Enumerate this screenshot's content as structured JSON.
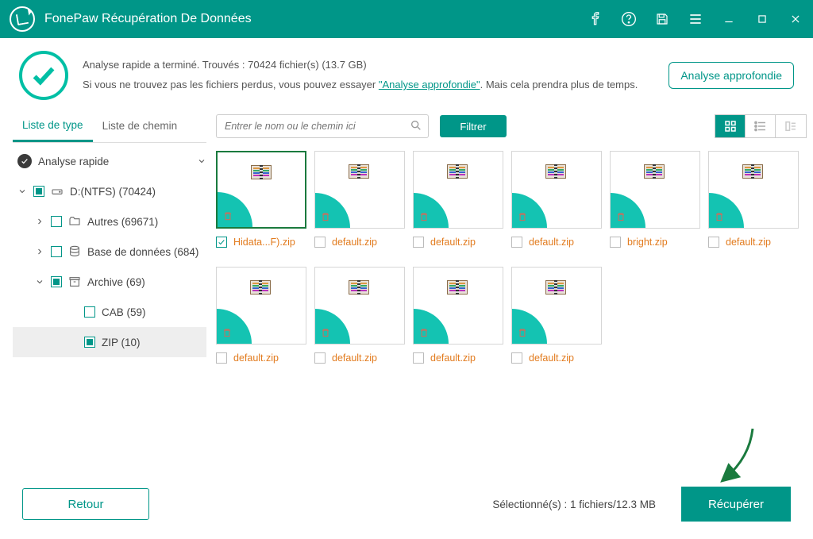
{
  "app": {
    "title": "FonePaw Récupération De Données"
  },
  "titlebar_icons": [
    "facebook-icon",
    "help-icon",
    "save-icon",
    "menu-icon",
    "minimize-icon",
    "maximize-icon",
    "close-icon"
  ],
  "summary": {
    "line1_prefix": "Analyse rapide a terminé. Trouvés : ",
    "count": "70424 fichier(s) (13.7 GB)",
    "line2_a": "Si vous ne trouvez pas les fichiers perdus, vous pouvez essayer ",
    "deep_scan_link": "\"Analyse approfondie\"",
    "line2_b": ". Mais cela prendra plus de temps.",
    "deep_scan_btn": "Analyse approfondie"
  },
  "tabs": {
    "type": "Liste de type",
    "path": "Liste de chemin"
  },
  "tree": {
    "quickscan": "Analyse rapide",
    "drive": "D:(NTFS) (70424)",
    "autres": "Autres (69671)",
    "db": "Base de données (684)",
    "archive": "Archive (69)",
    "cab": "CAB (59)",
    "zip": "ZIP (10)"
  },
  "toolbar": {
    "search_placeholder": "Entrer le nom ou le chemin ici",
    "filter": "Filtrer"
  },
  "files": [
    {
      "name": "Hidata...F).zip",
      "checked": true
    },
    {
      "name": "default.zip",
      "checked": false
    },
    {
      "name": "default.zip",
      "checked": false
    },
    {
      "name": "default.zip",
      "checked": false
    },
    {
      "name": "bright.zip",
      "checked": false
    },
    {
      "name": "default.zip",
      "checked": false
    },
    {
      "name": "default.zip",
      "checked": false
    },
    {
      "name": "default.zip",
      "checked": false
    },
    {
      "name": "default.zip",
      "checked": false
    },
    {
      "name": "default.zip",
      "checked": false
    }
  ],
  "footer": {
    "back": "Retour",
    "status": "Sélectionné(s) : 1 fichiers/12.3 MB",
    "recover": "Récupérer"
  },
  "colors": {
    "brand": "#009688",
    "accent": "#14c3b2",
    "filename": "#e27b1e"
  }
}
